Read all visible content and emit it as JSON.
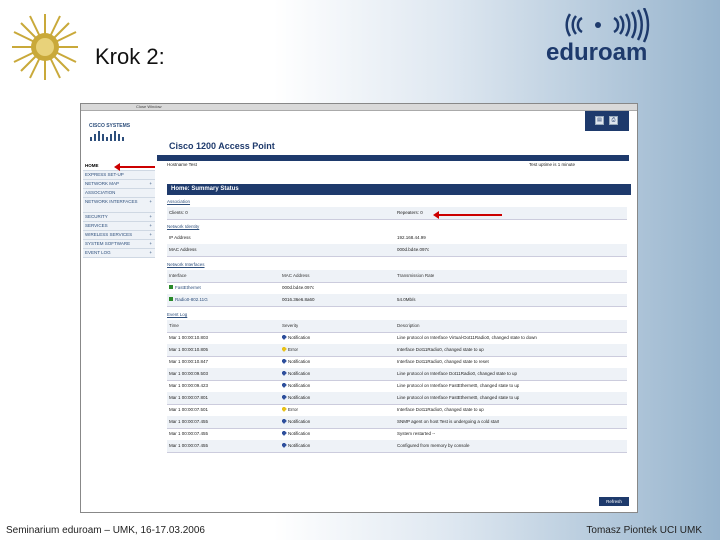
{
  "slide": {
    "title": "Krok 2:",
    "footer_left": "Seminarium eduroam – UMK, 16-17.03.2006",
    "footer_right": "Tomasz Piontek UCI UMK",
    "logo_text": "eduroam"
  },
  "browser": {
    "toolbar_label": "Close Window"
  },
  "cisco": {
    "brand": "CISCO SYSTEMS",
    "page_title": "Cisco 1200 Access Point",
    "hostname_label": "Hostname Test",
    "uptime_label": "Test uptime is 1 minute",
    "section_title": "Home: Summary Status",
    "nav": [
      {
        "label": "HOME",
        "plus": ""
      },
      {
        "label": "EXPRESS SET-UP",
        "plus": ""
      },
      {
        "label": "NETWORK MAP",
        "plus": "+"
      },
      {
        "label": "ASSOCIATION",
        "plus": ""
      },
      {
        "label": "NETWORK INTERFACES",
        "plus": "+"
      },
      {
        "label": "SECURITY",
        "plus": "+"
      },
      {
        "label": "SERVICES",
        "plus": "+"
      },
      {
        "label": "WIRELESS SERVICES",
        "plus": "+"
      },
      {
        "label": "SYSTEM SOFTWARE",
        "plus": "+"
      },
      {
        "label": "EVENT LOG",
        "plus": "+"
      }
    ],
    "association": {
      "heading": "Association",
      "clients": "Clients: 0",
      "repeaters": "Repeaters: 0"
    },
    "network_identity": {
      "heading": "Network Identity",
      "ip_label": "IP Address",
      "ip_value": "192.168.44.99",
      "mac_label": "MAC Address",
      "mac_value": "000d.bd4e.097c"
    },
    "network_interfaces": {
      "heading": "Network Interfaces",
      "columns": [
        "Interface",
        "MAC Address",
        "Transmission Rate"
      ],
      "rows": [
        [
          "FastEthernet",
          "000d.bd4e.097c",
          ""
        ],
        [
          "Radio0-802.11G",
          "0016.36e6.8a60",
          "54.0Mb/s"
        ]
      ]
    },
    "event_log": {
      "heading": "Event Log",
      "columns": [
        "Time",
        "Severity",
        "Description"
      ],
      "rows": [
        [
          "Mar 1 00:00:10.803",
          "Notification",
          "Line protocol on Interface Virtual-Dot11Radio0, changed state to down"
        ],
        [
          "Mar 1 00:00:10.805",
          "Error",
          "Interface Dot11Radio0, changed state to up"
        ],
        [
          "Mar 1 00:00:10.847",
          "Notification",
          "Interface Dot11Radio0, changed state to reset"
        ],
        [
          "Mar 1 00:00:09.503",
          "Notification",
          "Line protocol on Interface Dot11Radio0, changed state to up"
        ],
        [
          "Mar 1 00:00:09.423",
          "Notification",
          "Line protocol on Interface FastEthernet0, changed state to up"
        ],
        [
          "Mar 1 00:00:07.801",
          "Notification",
          "Line protocol on Interface FastEthernet0, changed state to up"
        ],
        [
          "Mar 1 00:00:07.501",
          "Error",
          "Interface Dot11Radio0, changed state to up"
        ],
        [
          "Mar 1 00:00:07.455",
          "Notification",
          "SNMP agent on host Test is undergoing a cold start"
        ],
        [
          "Mar 1 00:00:07.455",
          "Notification",
          "System restarted --"
        ],
        [
          "Mar 1 00:00:07.455",
          "Notification",
          "Configured from memory by console"
        ]
      ]
    },
    "refresh_label": "Refresh"
  },
  "colors": {
    "navy": "#1e3a6c",
    "arrow": "#cc0000",
    "notification": "#2e4f9c",
    "error": "#e8c21a"
  }
}
